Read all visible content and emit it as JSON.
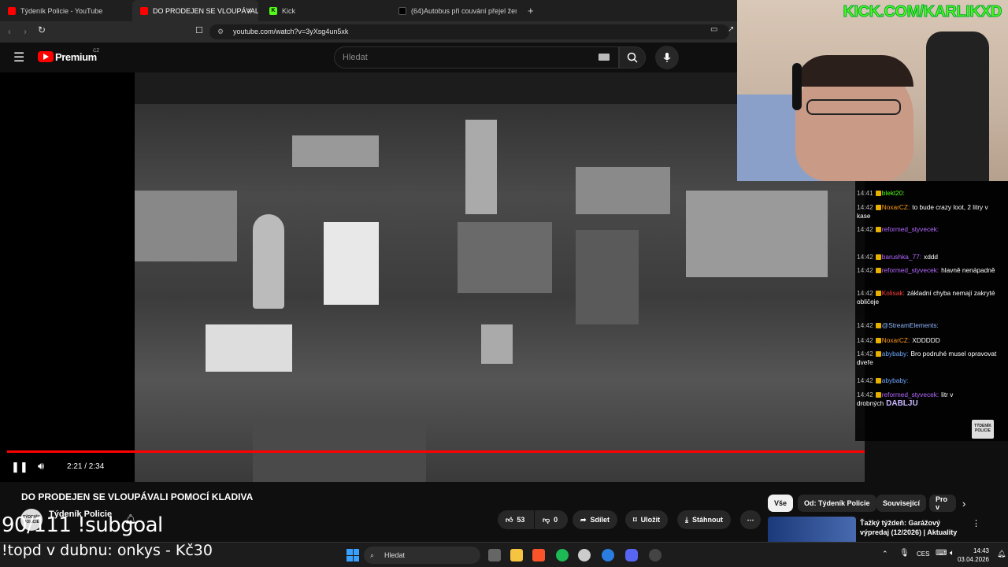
{
  "browser": {
    "tabs": [
      {
        "label": "Týdeník Policie - YouTube",
        "active": false
      },
      {
        "label": "DO PRODEJEN SE VLOUPÁVALI P",
        "active": true
      },
      {
        "label": "Kick",
        "active": false
      },
      {
        "label": "(64)Autobus při couvání přejel ženu,",
        "active": false
      }
    ],
    "url": "youtube.com/watch?v=3yXsg4un5xk",
    "new_tab": "+",
    "close": "×"
  },
  "youtube": {
    "logo": "Premium",
    "logo_region": "CZ",
    "search_placeholder": "Hledat",
    "player": {
      "time": "2:21 / 2:34",
      "progress": 0.916
    },
    "video_title": "DO PRODEJEN SE VLOUPÁVALI POMOCÍ KLADIVA",
    "channel": "Týdeník Policie",
    "channel_avatar_text": "TÝDENÍK POLICIE",
    "actions": {
      "likes": "53",
      "dislikes": "0",
      "share": "Sdílet",
      "save": "Uložit",
      "download": "Stáhnout"
    },
    "chips": [
      "Vše",
      "Od: Týdeník Policie",
      "Související",
      "Pro v"
    ],
    "next_video_title": "Ťažký týždeň: Garážový výpredaj (12/2026) | Aktuality"
  },
  "stream_overlay": {
    "kick_url": "KICK.COM/KARLIKXD",
    "subgoal": "90/111 !subgoal",
    "topd": "!topd v dubnu: onkys - Kč30",
    "watermark": "TÝDENÍK POLICIE"
  },
  "chat": [
    {
      "time": "14:41",
      "user": "blekt20:",
      "color": "#53fc18",
      "text": ""
    },
    {
      "time": "14:42",
      "user": "NoxarCZ:",
      "color": "#ff9a1a",
      "text": "to bude crazy loot, 2 litry v kase"
    },
    {
      "time": "14:42",
      "user": "reformed_styvecek:",
      "color": "#b469ff",
      "text": ""
    },
    {
      "time": "14:42",
      "user": "barushka_77:",
      "color": "#b469ff",
      "text": "xddd"
    },
    {
      "time": "14:42",
      "user": "reformed_styvecek:",
      "color": "#b469ff",
      "text": "hlavně nenápadně"
    },
    {
      "time": "14:42",
      "user": "Kolisak:",
      "color": "#ff4040",
      "text": "základní chyba nemají zakryté obličeje"
    },
    {
      "time": "14:42",
      "user": "@StreamElements:",
      "color": "#8fb7ff",
      "text": ""
    },
    {
      "time": "14:42",
      "user": "NoxarCZ:",
      "color": "#ff9a1a",
      "text": "XDDDDD"
    },
    {
      "time": "14:42",
      "user": "abybaby:",
      "color": "#6fa8ff",
      "text": "Bro podruhé musel opravovat dveře"
    },
    {
      "time": "14:42",
      "user": "abybaby:",
      "color": "#6fa8ff",
      "text": ""
    },
    {
      "time": "14:42",
      "user": "reformed_styvecek:",
      "color": "#b469ff",
      "text": "litr v drobných"
    }
  ],
  "chat_emote_text": "DABLJU",
  "taskbar": {
    "search_placeholder": "Hledat",
    "lang": "CES",
    "time": "14:43",
    "date": "03.04.2026"
  }
}
